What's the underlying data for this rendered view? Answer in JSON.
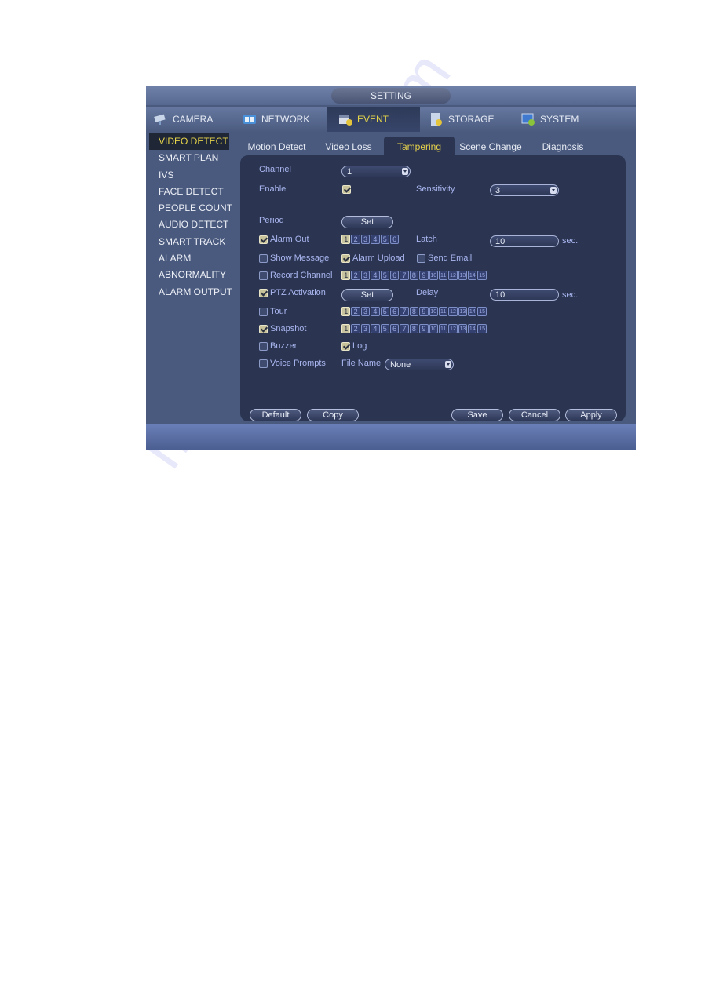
{
  "window": {
    "title": "SETTING"
  },
  "main_nav": [
    {
      "label": "CAMERA",
      "icon": "camera-icon",
      "active": false
    },
    {
      "label": "NETWORK",
      "icon": "network-icon",
      "active": false
    },
    {
      "label": "EVENT",
      "icon": "event-icon",
      "active": true
    },
    {
      "label": "STORAGE",
      "icon": "storage-icon",
      "active": false
    },
    {
      "label": "SYSTEM",
      "icon": "system-icon",
      "active": false
    }
  ],
  "sidebar": {
    "items": [
      {
        "label": "VIDEO DETECT",
        "active": true
      },
      {
        "label": "SMART PLAN"
      },
      {
        "label": "IVS"
      },
      {
        "label": "FACE DETECT"
      },
      {
        "label": "PEOPLE COUNT"
      },
      {
        "label": "AUDIO DETECT"
      },
      {
        "label": "SMART TRACK"
      },
      {
        "label": "ALARM"
      },
      {
        "label": "ABNORMALITY"
      },
      {
        "label": "ALARM OUTPUT"
      }
    ]
  },
  "tabs": [
    {
      "label": "Motion Detect"
    },
    {
      "label": "Video Loss"
    },
    {
      "label": "Tampering",
      "active": true
    },
    {
      "label": "Scene Change"
    },
    {
      "label": "Diagnosis"
    }
  ],
  "form": {
    "channel": {
      "label": "Channel",
      "value": "1"
    },
    "enable": {
      "label": "Enable",
      "checked": true
    },
    "sensitivity": {
      "label": "Sensitivity",
      "value": "3"
    },
    "period": {
      "label": "Period",
      "button": "Set"
    },
    "alarm_out": {
      "label": "Alarm Out",
      "checked": true,
      "channels": [
        "1",
        "2",
        "3",
        "4",
        "5",
        "6"
      ],
      "selected": [
        "1"
      ]
    },
    "latch": {
      "label": "Latch",
      "value": "10",
      "unit": "sec."
    },
    "show_message": {
      "label": "Show Message",
      "checked": false
    },
    "alarm_upload": {
      "label": "Alarm Upload",
      "checked": true
    },
    "send_email": {
      "label": "Send Email",
      "checked": false
    },
    "record_channel": {
      "label": "Record Channel",
      "checked": false,
      "channels": [
        "1",
        "2",
        "3",
        "4",
        "5",
        "6",
        "7",
        "8",
        "9",
        "10",
        "11",
        "12",
        "13",
        "14",
        "15"
      ],
      "selected": [
        "1"
      ]
    },
    "ptz_activation": {
      "label": "PTZ Activation",
      "checked": true,
      "button": "Set"
    },
    "delay": {
      "label": "Delay",
      "value": "10",
      "unit": "sec."
    },
    "tour": {
      "label": "Tour",
      "checked": false,
      "channels": [
        "1",
        "2",
        "3",
        "4",
        "5",
        "6",
        "7",
        "8",
        "9",
        "10",
        "11",
        "12",
        "13",
        "14",
        "15"
      ],
      "selected": [
        "1"
      ]
    },
    "snapshot": {
      "label": "Snapshot",
      "checked": true,
      "channels": [
        "1",
        "2",
        "3",
        "4",
        "5",
        "6",
        "7",
        "8",
        "9",
        "10",
        "11",
        "12",
        "13",
        "14",
        "15"
      ],
      "selected": [
        "1"
      ]
    },
    "buzzer": {
      "label": "Buzzer",
      "checked": false
    },
    "log": {
      "label": "Log",
      "checked": true
    },
    "voice_prompts": {
      "label": "Voice Prompts",
      "checked": false
    },
    "file_name": {
      "label": "File Name",
      "value": "None"
    }
  },
  "buttons": {
    "default": "Default",
    "copy": "Copy",
    "save": "Save",
    "cancel": "Cancel",
    "apply": "Apply"
  },
  "watermark": "manualshive.com"
}
